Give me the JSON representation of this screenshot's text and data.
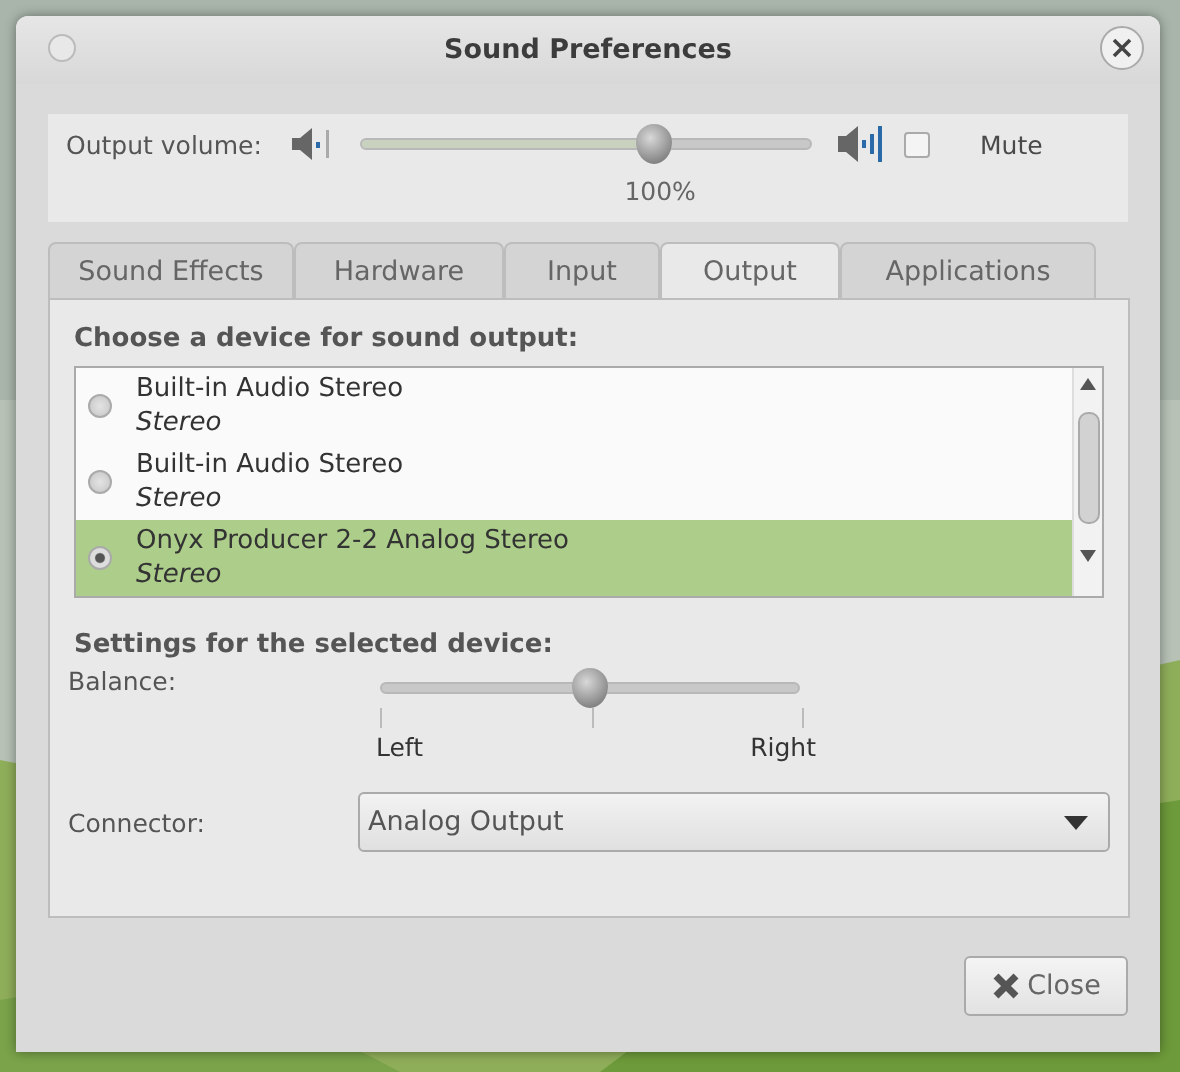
{
  "window": {
    "title": "Sound Preferences"
  },
  "output_volume": {
    "label": "Output volume:",
    "level": 0.65,
    "reading": "100%",
    "mute": {
      "label": "Mute",
      "checked": false
    }
  },
  "tabs": [
    {
      "label": "Sound Effects",
      "selected": false
    },
    {
      "label": "Hardware",
      "selected": false
    },
    {
      "label": "Input",
      "selected": false
    },
    {
      "label": "Output",
      "selected": true
    },
    {
      "label": "Applications",
      "selected": false
    }
  ],
  "device_heading": "Choose a device for sound output:",
  "devices": [
    {
      "name": "Built-in Audio Stereo",
      "profile": "Stereo",
      "selected": false
    },
    {
      "name": "Built-in Audio Stereo",
      "profile": "Stereo",
      "selected": false
    },
    {
      "name": "Onyx Producer 2-2 Analog Stereo",
      "profile": "Stereo",
      "selected": true
    }
  ],
  "settings_heading": "Settings for the selected device:",
  "balance": {
    "label": "Balance:",
    "level": 0.5,
    "left": "Left",
    "right": "Right"
  },
  "connector": {
    "label": "Connector:",
    "value": "Analog Output"
  },
  "buttons": [
    {
      "label": "Close"
    }
  ]
}
